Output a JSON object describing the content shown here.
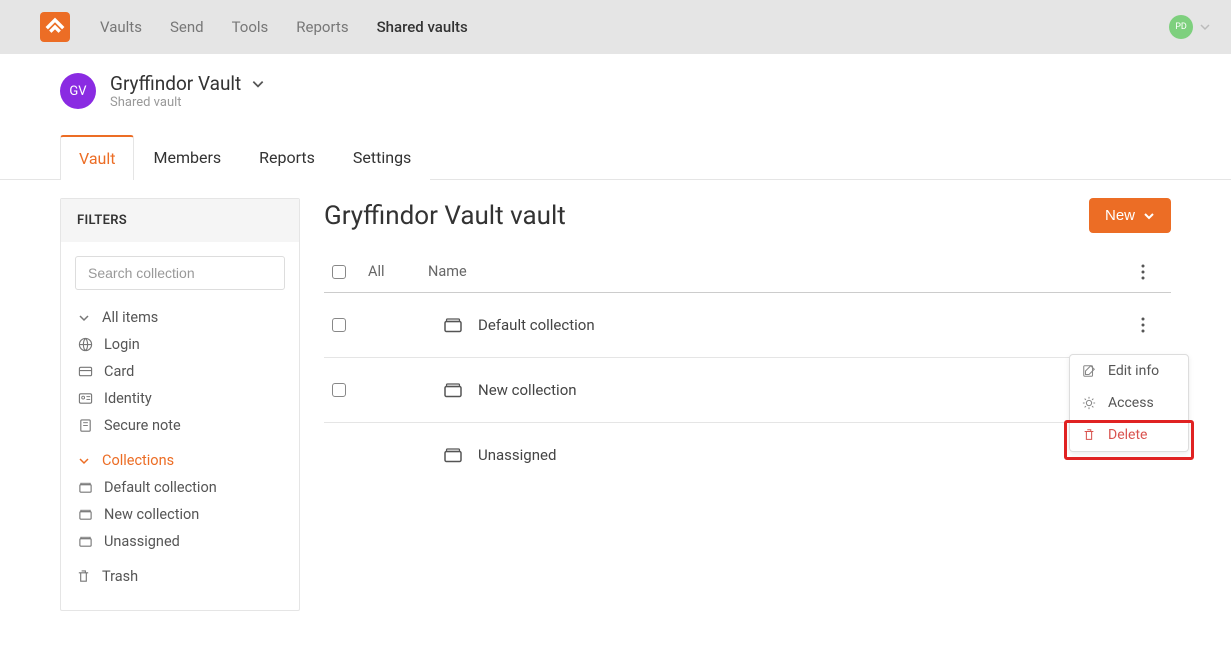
{
  "topnav": {
    "items": [
      {
        "label": "Vaults"
      },
      {
        "label": "Send"
      },
      {
        "label": "Tools"
      },
      {
        "label": "Reports"
      },
      {
        "label": "Shared vaults"
      }
    ],
    "active_index": 4
  },
  "user": {
    "initials": "PD"
  },
  "vault": {
    "avatar_initials": "GV",
    "title": "Gryffindor Vault",
    "subtitle": "Shared vault"
  },
  "tabs": {
    "items": [
      {
        "label": "Vault"
      },
      {
        "label": "Members"
      },
      {
        "label": "Reports"
      },
      {
        "label": "Settings"
      }
    ],
    "active_index": 0
  },
  "sidebar": {
    "header": "FILTERS",
    "search_placeholder": "Search collection",
    "all_items": "All items",
    "types": [
      {
        "label": "Login",
        "icon": "globe-icon"
      },
      {
        "label": "Card",
        "icon": "card-icon"
      },
      {
        "label": "Identity",
        "icon": "id-icon"
      },
      {
        "label": "Secure note",
        "icon": "note-icon"
      }
    ],
    "collections_label": "Collections",
    "collections": [
      {
        "label": "Default collection"
      },
      {
        "label": "New collection"
      },
      {
        "label": "Unassigned"
      }
    ],
    "trash": "Trash"
  },
  "main": {
    "title": "Gryffindor Vault vault",
    "new_button": "New",
    "table": {
      "all_label": "All",
      "name_header": "Name",
      "rows": [
        {
          "name": "Default collection",
          "has_checkbox": true
        },
        {
          "name": "New collection",
          "has_checkbox": true
        },
        {
          "name": "Unassigned",
          "has_checkbox": false
        }
      ]
    }
  },
  "context_menu": {
    "items": [
      {
        "label": "Edit info",
        "icon": "edit-icon"
      },
      {
        "label": "Access",
        "icon": "gear-icon"
      },
      {
        "label": "Delete",
        "icon": "trash-icon",
        "danger": true
      }
    ]
  },
  "colors": {
    "accent": "#ec6d25",
    "purple": "#8a2be2",
    "danger": "#d9534f",
    "highlight": "#e02222"
  }
}
